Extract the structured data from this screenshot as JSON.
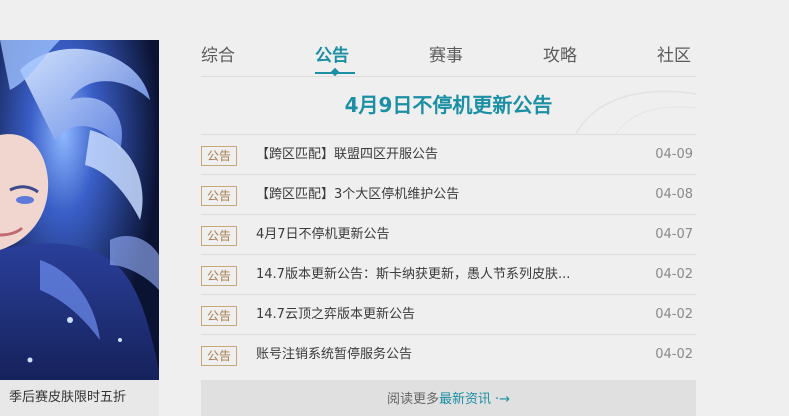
{
  "promo": {
    "caption": "季后赛皮肤限时五折"
  },
  "tabs": [
    {
      "label": "综合"
    },
    {
      "label": "公告"
    },
    {
      "label": "赛事"
    },
    {
      "label": "攻略"
    },
    {
      "label": "社区"
    }
  ],
  "active_tab_index": 1,
  "headline": "4月9日不停机更新公告",
  "news": [
    {
      "tag": "公告",
      "title": "【跨区匹配】联盟四区开服公告",
      "date": "04-09"
    },
    {
      "tag": "公告",
      "title": "【跨区匹配】3个大区停机维护公告",
      "date": "04-08"
    },
    {
      "tag": "公告",
      "title": "4月7日不停机更新公告",
      "date": "04-07"
    },
    {
      "tag": "公告",
      "title": "14.7版本更新公告：斯卡纳获更新，愚人节系列皮肤...",
      "date": "04-02"
    },
    {
      "tag": "公告",
      "title": "14.7云顶之弈版本更新公告",
      "date": "04-02"
    },
    {
      "tag": "公告",
      "title": "账号注销系统暂停服务公告",
      "date": "04-02"
    }
  ],
  "read_more": {
    "prefix": "阅读更多",
    "highlight": "最新资讯",
    "arrow": "·→"
  },
  "colors": {
    "accent": "#1b8fa3",
    "tag_border": "#c9a77d",
    "background": "#efefef"
  }
}
